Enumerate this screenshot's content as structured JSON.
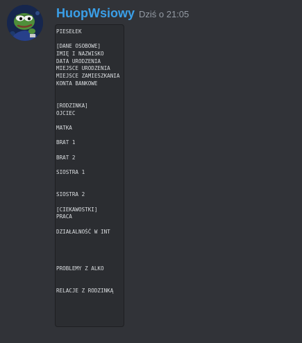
{
  "message": {
    "author": "HuopWsiowy",
    "timestamp": "Dziś o 21:05",
    "colors": {
      "username": "#3a9fe8",
      "timestamp": "#949ba4",
      "code_background": "#2b2d31",
      "background": "#313338"
    },
    "avatar_icon": "pepe-frog-avatar-icon",
    "code_lines": [
      "PIESEŁEK",
      "",
      "[DANE OSOBOWE]",
      "IMIĘ I NAZWISKO",
      "DATA URODZENIA",
      "MIEJSCE URODZENIA",
      "MIEJSCE ZAMIESZKANIA",
      "KONTA BANKOWE",
      "",
      "",
      "[RODZINKA]",
      "OJCIEC",
      "",
      "MATKA",
      "",
      "BRAT 1",
      "",
      "BRAT 2",
      "",
      "SIOSTRA 1",
      "",
      "",
      "SIOSTRA 2",
      "",
      "[CIEKAWOSTKI]",
      "PRACA",
      "",
      "DZIAŁALNOŚĆ W INT",
      "",
      "",
      "",
      "",
      "PROBLEMY Z ALKO",
      "",
      "",
      "RELACJE Z RODZINKĄ"
    ]
  }
}
